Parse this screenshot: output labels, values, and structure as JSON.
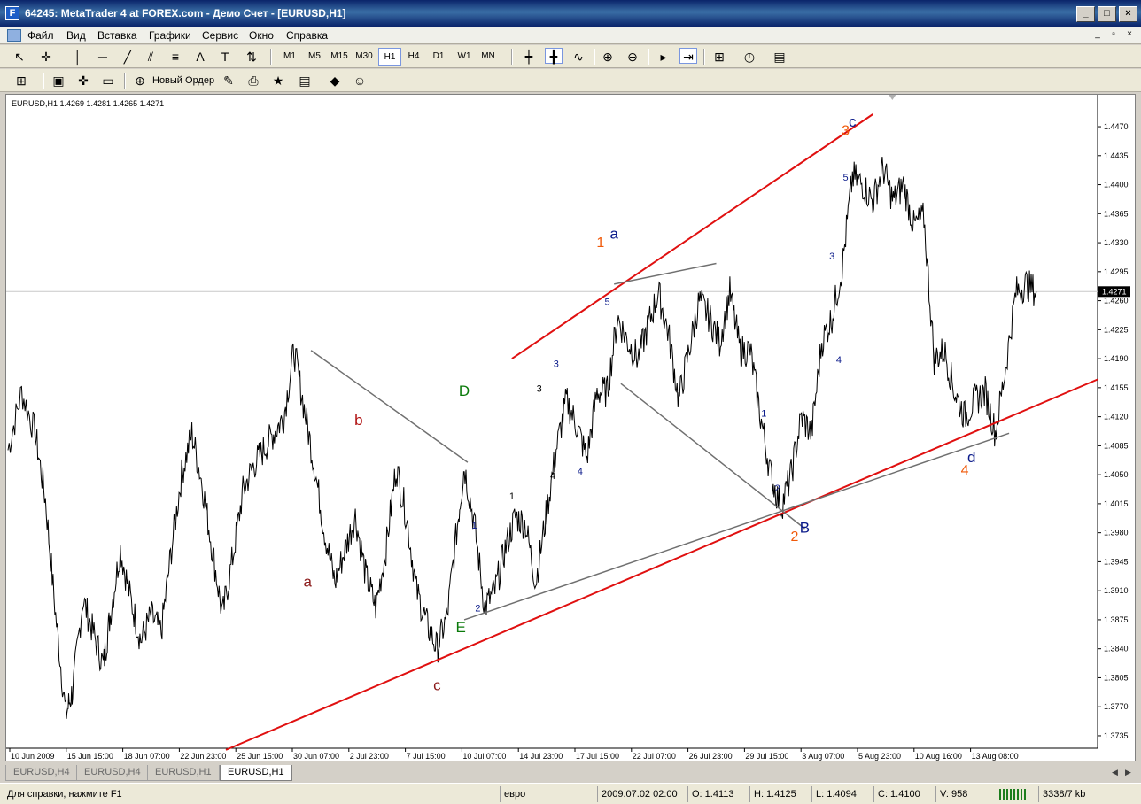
{
  "window": {
    "title": "64245: MetaTrader 4 at FOREX.com - Демо Счет - [EURUSD,H1]",
    "app_icon_glyph": "F"
  },
  "menu": {
    "items": [
      "Файл",
      "Вид",
      "Вставка",
      "Графики",
      "Сервис",
      "Окно",
      "Справка"
    ]
  },
  "toolbar": {
    "timeframes": [
      "M1",
      "M5",
      "M15",
      "M30",
      "H1",
      "H4",
      "D1",
      "W1",
      "MN"
    ],
    "active_timeframe": "H1",
    "new_order_label": "Новый Ордер"
  },
  "chart": {
    "info": "EURUSD,H1  1.4269 1.4281 1.4265 1.4271",
    "current_price": "1.4271",
    "line_color": "#000000",
    "trend_color": "#e01010",
    "channel_color": "#707070"
  },
  "chart_data": {
    "type": "line",
    "symbol": "EURUSD",
    "timeframe": "H1",
    "y_ticks": [
      "1.4470",
      "1.4435",
      "1.4400",
      "1.4365",
      "1.4330",
      "1.4295",
      "1.4260",
      "1.4225",
      "1.4190",
      "1.4155",
      "1.4120",
      "1.4085",
      "1.4050",
      "1.4015",
      "1.3980",
      "1.3945",
      "1.3910",
      "1.3875",
      "1.3840",
      "1.3805",
      "1.3770",
      "1.3735"
    ],
    "ylim": [
      1.372,
      1.4485
    ],
    "x_ticks": [
      "10 Jun 2009",
      "15 Jun 15:00",
      "18 Jun 07:00",
      "22 Jun 23:00",
      "25 Jun 15:00",
      "30 Jun 07:00",
      "2 Jul 23:00",
      "7 Jul 15:00",
      "10 Jul 07:00",
      "14 Jul 23:00",
      "17 Jul 15:00",
      "22 Jul 07:00",
      "26 Jul 23:00",
      "29 Jul 15:00",
      "3 Aug 07:00",
      "5 Aug 23:00",
      "10 Aug 16:00",
      "13 Aug 08:00"
    ],
    "price_path": [
      [
        0,
        1.408
      ],
      [
        4,
        1.415
      ],
      [
        8,
        1.41
      ],
      [
        11,
        1.402
      ],
      [
        14,
        1.388
      ],
      [
        17,
        1.376
      ],
      [
        19,
        1.379
      ],
      [
        22,
        1.39
      ],
      [
        25,
        1.386
      ],
      [
        28,
        1.382
      ],
      [
        30,
        1.388
      ],
      [
        33,
        1.396
      ],
      [
        36,
        1.39
      ],
      [
        39,
        1.385
      ],
      [
        42,
        1.388
      ],
      [
        45,
        1.386
      ],
      [
        48,
        1.396
      ],
      [
        51,
        1.405
      ],
      [
        54,
        1.41
      ],
      [
        57,
        1.404
      ],
      [
        60,
        1.396
      ],
      [
        63,
        1.388
      ],
      [
        66,
        1.395
      ],
      [
        69,
        1.403
      ],
      [
        72,
        1.406
      ],
      [
        75,
        1.408
      ],
      [
        78,
        1.41
      ],
      [
        81,
        1.412
      ],
      [
        84,
        1.42
      ],
      [
        87,
        1.413
      ],
      [
        90,
        1.406
      ],
      [
        93,
        1.398
      ],
      [
        96,
        1.392
      ],
      [
        99,
        1.396
      ],
      [
        102,
        1.4
      ],
      [
        105,
        1.393
      ],
      [
        108,
        1.389
      ],
      [
        111,
        1.396
      ],
      [
        114,
        1.406
      ],
      [
        117,
        1.4
      ],
      [
        120,
        1.391
      ],
      [
        123,
        1.387
      ],
      [
        126,
        1.384
      ],
      [
        129,
        1.388
      ],
      [
        132,
        1.399
      ],
      [
        134,
        1.406
      ],
      [
        137,
        1.399
      ],
      [
        140,
        1.389
      ],
      [
        143,
        1.391
      ],
      [
        146,
        1.396
      ],
      [
        149,
        1.4
      ],
      [
        152,
        1.399
      ],
      [
        155,
        1.392
      ],
      [
        158,
        1.4
      ],
      [
        161,
        1.408
      ],
      [
        164,
        1.414
      ],
      [
        167,
        1.411
      ],
      [
        170,
        1.407
      ],
      [
        173,
        1.415
      ],
      [
        176,
        1.415
      ],
      [
        179,
        1.424
      ],
      [
        182,
        1.421
      ],
      [
        185,
        1.419
      ],
      [
        188,
        1.423
      ],
      [
        191,
        1.427
      ],
      [
        194,
        1.422
      ],
      [
        197,
        1.414
      ],
      [
        200,
        1.42
      ],
      [
        203,
        1.426
      ],
      [
        206,
        1.424
      ],
      [
        209,
        1.421
      ],
      [
        212,
        1.427
      ],
      [
        215,
        1.42
      ],
      [
        218,
        1.42
      ],
      [
        221,
        1.412
      ],
      [
        224,
        1.405
      ],
      [
        227,
        1.401
      ],
      [
        230,
        1.405
      ],
      [
        233,
        1.412
      ],
      [
        236,
        1.41
      ],
      [
        239,
        1.421
      ],
      [
        242,
        1.424
      ],
      [
        245,
        1.43
      ],
      [
        248,
        1.441
      ],
      [
        251,
        1.44
      ],
      [
        254,
        1.438
      ],
      [
        257,
        1.442
      ],
      [
        260,
        1.438
      ],
      [
        263,
        1.44
      ],
      [
        266,
        1.435
      ],
      [
        269,
        1.436
      ],
      [
        272,
        1.419
      ],
      [
        275,
        1.42
      ],
      [
        278,
        1.415
      ],
      [
        281,
        1.412
      ],
      [
        284,
        1.414
      ],
      [
        287,
        1.415
      ],
      [
        290,
        1.41
      ],
      [
        293,
        1.418
      ],
      [
        296,
        1.427
      ],
      [
        299,
        1.428
      ],
      [
        302,
        1.4271
      ]
    ],
    "waves": [
      {
        "label": "a",
        "color": "#8b1a1a",
        "x": 88,
        "y": 1.3915
      },
      {
        "label": "b",
        "color": "#b01010",
        "x": 103,
        "y": 1.411
      },
      {
        "label": "c",
        "color": "#8b1a1a",
        "x": 126,
        "y": 1.379
      },
      {
        "label": "D",
        "color": "#0a7a0a",
        "x": 134,
        "y": 1.4145
      },
      {
        "label": "E",
        "color": "#0a7a0a",
        "x": 133,
        "y": 1.386
      },
      {
        "label": "a",
        "color": "#0a1a8a",
        "x": 178,
        "y": 1.4335
      },
      {
        "label": "B",
        "color": "#0a1a8a",
        "x": 234,
        "y": 1.398
      },
      {
        "label": "c",
        "color": "#0a1a8a",
        "x": 248,
        "y": 1.447
      },
      {
        "label": "d",
        "color": "#0a1a8a",
        "x": 283,
        "y": 1.4065
      },
      {
        "label": "1",
        "color": "#f05a0a",
        "x": 174,
        "y": 1.4325
      },
      {
        "label": "2",
        "color": "#f05a0a",
        "x": 231,
        "y": 1.397
      },
      {
        "label": "3",
        "color": "#f05a0a",
        "x": 246,
        "y": 1.446
      },
      {
        "label": "4",
        "color": "#f05a0a",
        "x": 281,
        "y": 1.405
      },
      {
        "label": "1",
        "color": "#000000",
        "x": 148,
        "y": 1.402
      },
      {
        "label": "1",
        "color": "#0a1a8a",
        "x": 137,
        "y": 1.3985
      },
      {
        "label": "2",
        "color": "#0a1a8a",
        "x": 138,
        "y": 1.3885
      },
      {
        "label": "3",
        "color": "#000000",
        "x": 156,
        "y": 1.415
      },
      {
        "label": "3",
        "color": "#0a1a8a",
        "x": 161,
        "y": 1.418
      },
      {
        "label": "4",
        "color": "#000000",
        "x": 160,
        "y": 1.4045
      },
      {
        "label": "4",
        "color": "#0a1a8a",
        "x": 168,
        "y": 1.405
      },
      {
        "label": "5",
        "color": "#0a1a8a",
        "x": 176,
        "y": 1.4255
      },
      {
        "label": "1",
        "color": "#0a1a8a",
        "x": 222,
        "y": 1.412
      },
      {
        "label": "2",
        "color": "#0a1a8a",
        "x": 226,
        "y": 1.403
      },
      {
        "label": "3",
        "color": "#0a1a8a",
        "x": 242,
        "y": 1.431
      },
      {
        "label": "4",
        "color": "#0a1a8a",
        "x": 244,
        "y": 1.4185
      },
      {
        "label": "5",
        "color": "#0a1a8a",
        "x": 246,
        "y": 1.4405
      }
    ],
    "trendlines": [
      {
        "color": "#e01010",
        "from": [
          64,
          1.3718
        ],
        "to": [
          320,
          1.4165
        ]
      },
      {
        "color": "#e01010",
        "from": [
          148,
          1.419
        ],
        "to": [
          254,
          1.4485
        ]
      },
      {
        "color": "#707070",
        "from": [
          134,
          1.3875
        ],
        "to": [
          294,
          1.41
        ]
      },
      {
        "color": "#707070",
        "from": [
          89,
          1.42
        ],
        "to": [
          135,
          1.4065
        ]
      },
      {
        "color": "#707070",
        "from": [
          180,
          1.416
        ],
        "to": [
          234,
          1.3985
        ]
      },
      {
        "color": "#707070",
        "from": [
          178,
          1.428
        ],
        "to": [
          208,
          1.4305
        ]
      }
    ]
  },
  "tabs": {
    "items": [
      "EURUSD,H4",
      "EURUSD,H4",
      "EURUSD,H1",
      "EURUSD,H1"
    ],
    "active_index": 3
  },
  "status": {
    "help": "Для справки, нажмите F1",
    "profile": "евро",
    "datetime": "2009.07.02 02:00",
    "open": "O: 1.4113",
    "high": "H: 1.4125",
    "low": "L: 1.4094",
    "close": "C: 1.4100",
    "volume": "V: 958",
    "traffic": "3338/7 kb"
  }
}
